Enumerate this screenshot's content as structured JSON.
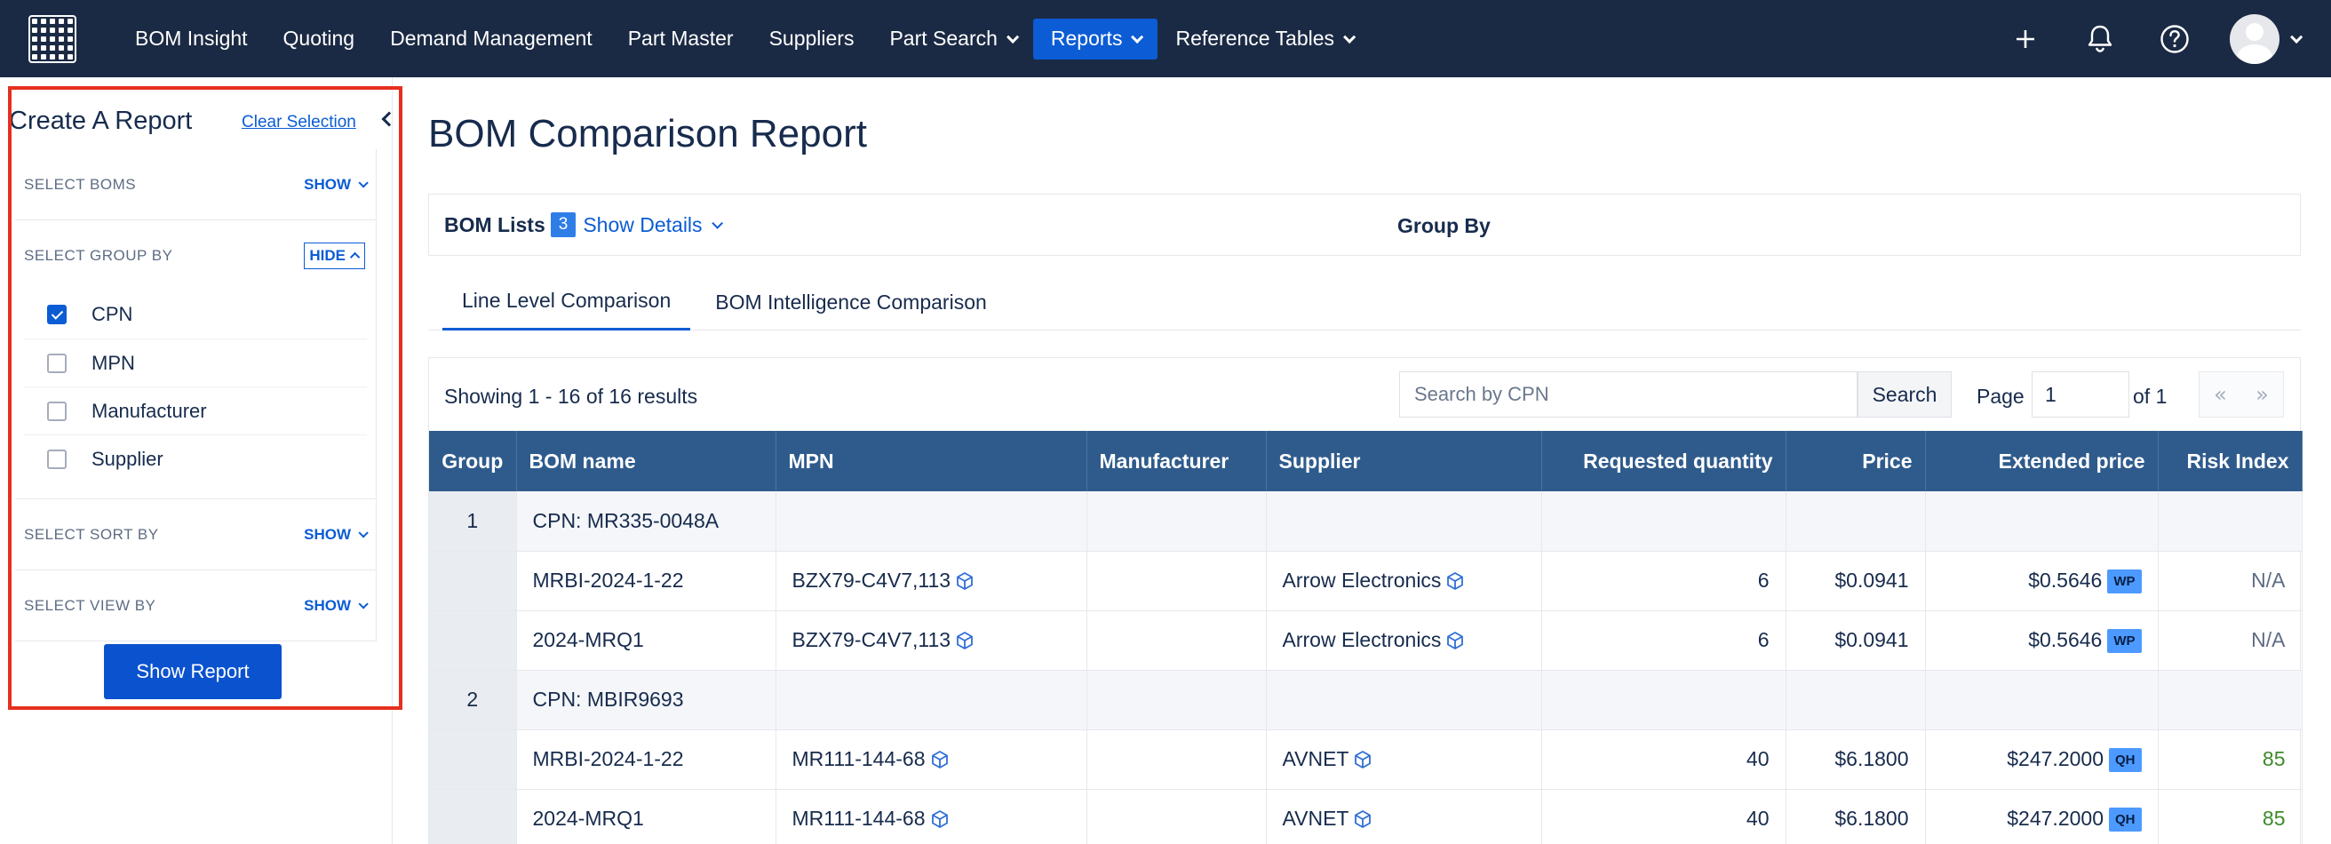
{
  "nav": {
    "items": [
      {
        "label": "BOM Insight",
        "dropdown": false,
        "active": false
      },
      {
        "label": "Quoting",
        "dropdown": false,
        "active": false
      },
      {
        "label": "Demand Management",
        "dropdown": false,
        "active": false
      },
      {
        "label": "Part Master",
        "dropdown": false,
        "active": false
      },
      {
        "label": "Suppliers",
        "dropdown": false,
        "active": false
      },
      {
        "label": "Part Search",
        "dropdown": true,
        "active": false
      },
      {
        "label": "Reports",
        "dropdown": true,
        "active": true
      },
      {
        "label": "Reference Tables",
        "dropdown": true,
        "active": false
      }
    ],
    "icons": [
      "plus-icon",
      "bell-icon",
      "help-icon"
    ],
    "active_color": "#0b5cd5",
    "background": "#1b2a44"
  },
  "sidebar": {
    "title": "Create A Report",
    "clear_label": "Clear Selection",
    "sections": {
      "boms": {
        "label": "SELECT BOMS",
        "toggle": "SHOW"
      },
      "group_by": {
        "label": "SELECT GROUP BY",
        "toggle": "HIDE",
        "options": [
          {
            "label": "CPN",
            "checked": true
          },
          {
            "label": "MPN",
            "checked": false
          },
          {
            "label": "Manufacturer",
            "checked": false
          },
          {
            "label": "Supplier",
            "checked": false
          }
        ]
      },
      "sort_by": {
        "label": "SELECT SORT BY",
        "toggle": "SHOW"
      },
      "view_by": {
        "label": "SELECT VIEW BY",
        "toggle": "SHOW"
      }
    },
    "button": "Show Report",
    "highlight_color": "#e5301f"
  },
  "main": {
    "title": "BOM Comparison Report",
    "bom_lists_label": "BOM Lists",
    "bom_count": "3",
    "show_details": "Show Details",
    "group_by_label": "Group By",
    "tabs": [
      {
        "label": "Line Level Comparison",
        "active": true
      },
      {
        "label": "BOM Intelligence Comparison",
        "active": false
      }
    ],
    "results": {
      "showing": "Showing 1 - 16 of 16 results",
      "search_placeholder": "Search by CPN",
      "search_button": "Search",
      "page_label": "Page",
      "page_value": "1",
      "of_label": "of 1",
      "prev": "«",
      "next": "»"
    },
    "table": {
      "headers": [
        "Group",
        "BOM name",
        "MPN",
        "Manufacturer",
        "Supplier",
        "Requested quantity",
        "Price",
        "Extended price",
        "Risk Index"
      ],
      "rows": [
        {
          "type": "group",
          "group": "1",
          "bom": "CPN: MR335-0048A"
        },
        {
          "type": "line",
          "group": "",
          "bom": "MRBI-2024-1-22",
          "mpn": "BZX79-C4V7,113",
          "manufacturer": "",
          "supplier": "Arrow Electronics",
          "qty": "6",
          "price": "$0.0941",
          "ext_price": "$0.5646",
          "tag": "WP",
          "risk": "N/A"
        },
        {
          "type": "line",
          "group": "",
          "bom": "2024-MRQ1",
          "mpn": "BZX79-C4V7,113",
          "manufacturer": "",
          "supplier": "Arrow Electronics",
          "qty": "6",
          "price": "$0.0941",
          "ext_price": "$0.5646",
          "tag": "WP",
          "risk": "N/A"
        },
        {
          "type": "group",
          "group": "2",
          "bom": "CPN: MBIR9693"
        },
        {
          "type": "line",
          "group": "",
          "bom": "MRBI-2024-1-22",
          "mpn": "MR111-144-68",
          "manufacturer": "",
          "supplier": "AVNET",
          "qty": "40",
          "price": "$6.1800",
          "ext_price": "$247.2000",
          "tag": "QH",
          "risk": "85"
        },
        {
          "type": "line",
          "group": "",
          "bom": "2024-MRQ1",
          "mpn": "MR111-144-68",
          "manufacturer": "",
          "supplier": "AVNET",
          "qty": "40",
          "price": "$6.1800",
          "ext_price": "$247.2000",
          "tag": "QH",
          "risk": "85"
        }
      ]
    },
    "header_color": "#2f5b8c",
    "risk_good_color": "#3d8a2a"
  }
}
